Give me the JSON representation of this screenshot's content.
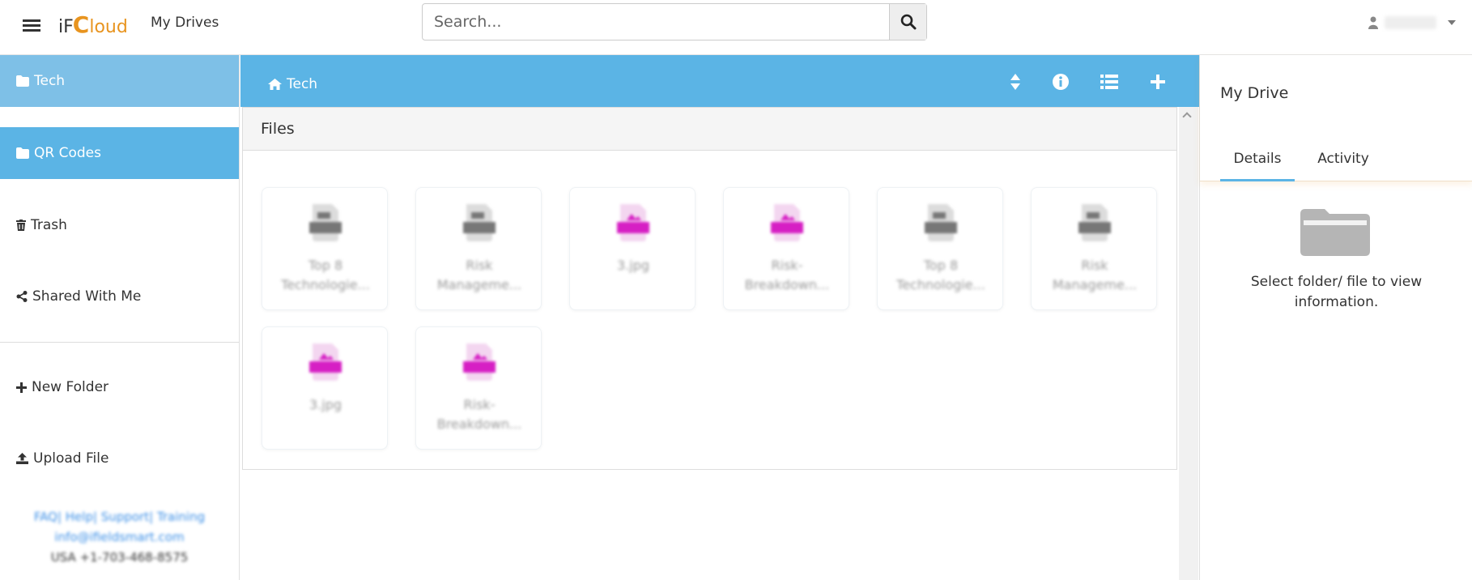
{
  "app": {
    "logo_prefix": "iF",
    "logo_c": "C",
    "logo_suffix": "loud",
    "title": "My Drives"
  },
  "search": {
    "placeholder": "Search..."
  },
  "sidebar": {
    "items": [
      {
        "label": "Tech",
        "icon": "folder-icon"
      },
      {
        "label": "QR Codes",
        "icon": "folder-icon"
      },
      {
        "label": "Trash",
        "icon": "trash-icon"
      },
      {
        "label": "Shared With Me",
        "icon": "share-icon"
      },
      {
        "label": "New Folder",
        "icon": "plus-icon"
      },
      {
        "label": "Upload File",
        "icon": "upload-icon"
      }
    ],
    "footer": {
      "links": "FAQ| Help| Support| Training",
      "email": "info@ifieldsmart.com",
      "phone": "USA  +1-703-468-8575"
    }
  },
  "main": {
    "breadcrumb": "Tech",
    "files_title": "Files",
    "files": [
      {
        "name_line1": "Top 8",
        "name_line2": "Technologie...",
        "type": "doc"
      },
      {
        "name_line1": "Risk",
        "name_line2": "Manageme...",
        "type": "doc"
      },
      {
        "name_line1": "3.jpg",
        "name_line2": "",
        "type": "jpg"
      },
      {
        "name_line1": "Risk-",
        "name_line2": "Breakdown...",
        "type": "jpg"
      },
      {
        "name_line1": "Top 8",
        "name_line2": "Technologie...",
        "type": "doc"
      },
      {
        "name_line1": "Risk",
        "name_line2": "Manageme...",
        "type": "doc"
      },
      {
        "name_line1": "3.jpg",
        "name_line2": "",
        "type": "jpg"
      },
      {
        "name_line1": "Risk-",
        "name_line2": "Breakdown...",
        "type": "jpg"
      }
    ]
  },
  "right_panel": {
    "title": "My Drive",
    "tabs": [
      "Details",
      "Activity"
    ],
    "message": "Select folder/ file to view information."
  },
  "colors": {
    "accent": "#5bb4e5",
    "accent_light": "#7ec0e7",
    "brand_orange": "#e8941f",
    "jpg_magenta": "#d61fc4",
    "doc_gray": "#777777"
  }
}
